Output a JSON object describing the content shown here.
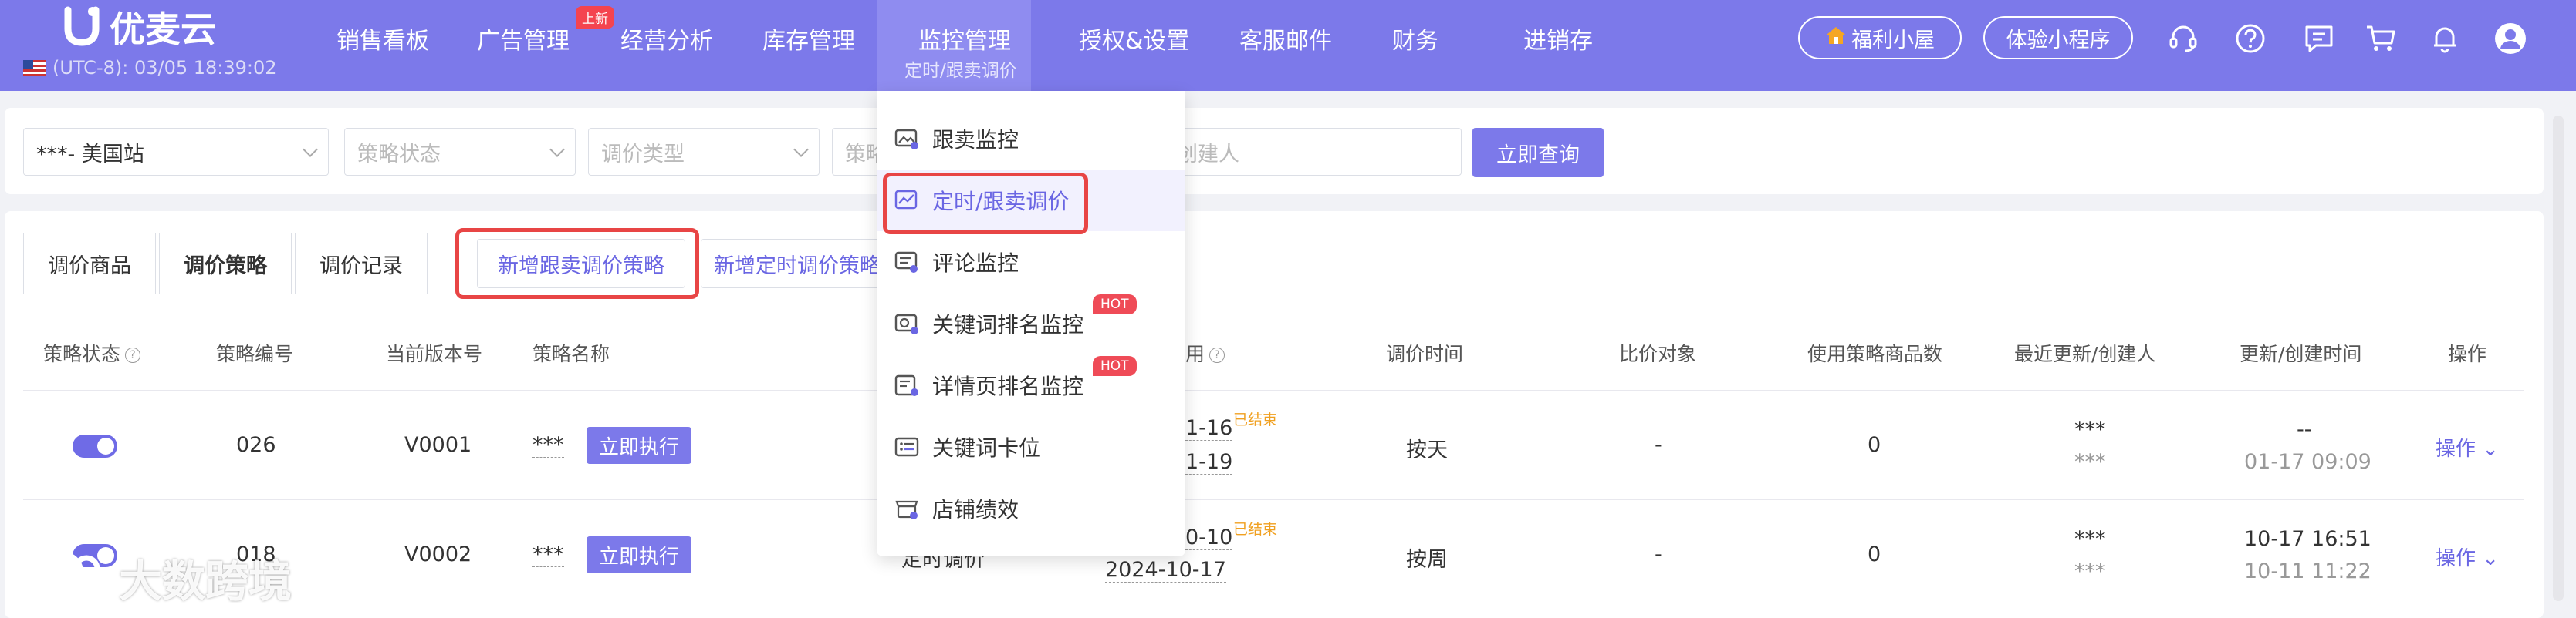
{
  "header": {
    "logo_text": "优麦云",
    "clock": "(UTC-8): 03/05 18:39:02",
    "nav": [
      {
        "label": "销售看板"
      },
      {
        "label": "广告管理",
        "badge": "上新"
      },
      {
        "label": "经营分析"
      },
      {
        "label": "库存管理"
      },
      {
        "label": "监控管理",
        "sub": "定时/跟卖调价",
        "active": true
      },
      {
        "label": "授权&设置"
      },
      {
        "label": "客服邮件"
      },
      {
        "label": "财务"
      },
      {
        "label": "进销存"
      }
    ],
    "welfare_label": "福利小屋",
    "miniapp_label": "体验小程序",
    "icons": [
      "headset-icon",
      "help-icon",
      "message-icon",
      "cart-icon",
      "bell-icon",
      "avatar-icon"
    ]
  },
  "filters": {
    "site": "***- 美国站",
    "strategy_status": "策略状态",
    "price_type": "调价类型",
    "strategy_partial": "策略",
    "creator": "创建人",
    "query_label": "立即查询"
  },
  "tabs": [
    "调价商品",
    "调价策略",
    "调价记录"
  ],
  "actions": {
    "add_follow": "新增跟卖调价策略",
    "add_timed": "新增定时调价策略"
  },
  "table": {
    "headers": [
      "策略状态",
      "策略编号",
      "当前版本号",
      "策略名称",
      "用",
      "调价时间",
      "比价对象",
      "使用策略商品数",
      "最近更新/创建人",
      "更新/创建时间",
      "操作"
    ],
    "rows": [
      {
        "id": "026",
        "version": "V0001",
        "name": "***",
        "run": "立即执行",
        "date_top": "1-16",
        "date_bottom": "1-19",
        "ended": "已结束",
        "time": "按天",
        "compare": "-",
        "count": "0",
        "updater": "***",
        "creator": "***",
        "update_time": "--",
        "create_time": "01-17 09:09",
        "ops": "操作"
      },
      {
        "id": "018",
        "version": "V0002",
        "name": "***",
        "run": "立即执行",
        "type": "定时调价",
        "date_top": "0-10",
        "date_bottom": "2024-10-17",
        "ended": "已结束",
        "time": "按周",
        "compare": "-",
        "count": "0",
        "updater": "***",
        "creator": "***",
        "update_time": "10-17 16:51",
        "create_time": "10-11 11:22",
        "ops": "操作"
      }
    ]
  },
  "dropdown": [
    {
      "label": "跟卖监控",
      "icon": "image-monitor-icon"
    },
    {
      "label": "定时/跟卖调价",
      "icon": "trend-chart-icon",
      "active": true
    },
    {
      "label": "评论监控",
      "icon": "comment-monitor-icon"
    },
    {
      "label": "关键词排名监控",
      "icon": "keyword-rank-icon",
      "hot": "HOT"
    },
    {
      "label": "详情页排名监控",
      "icon": "detail-rank-icon",
      "hot": "HOT"
    },
    {
      "label": "关键词卡位",
      "icon": "keyword-slot-icon"
    },
    {
      "label": "店铺绩效",
      "icon": "store-performance-icon"
    }
  ],
  "watermark": "大数跨境",
  "colors": {
    "primary": "#7c79ea",
    "highlight": "#e84545",
    "hot": "#ef4b57",
    "ended": "#f0a020"
  }
}
